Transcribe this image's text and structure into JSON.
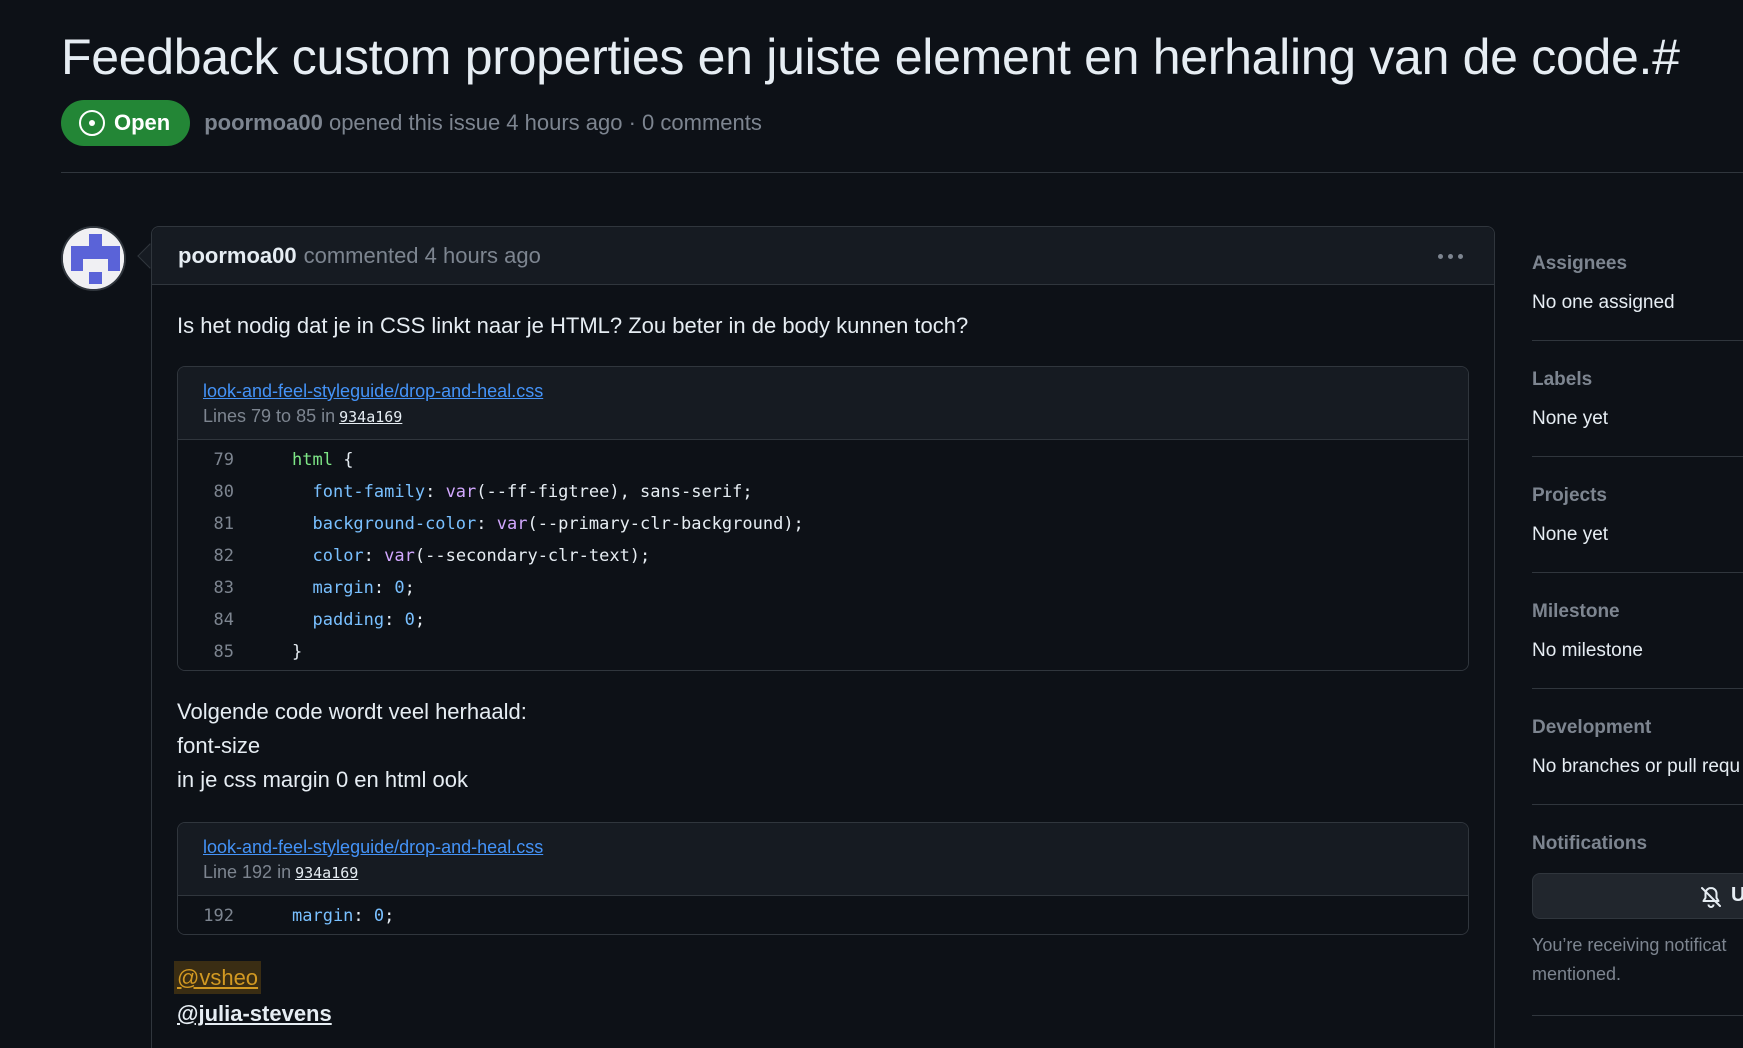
{
  "issue": {
    "title": "Feedback custom properties en juiste element en herhaling van de code.",
    "number_prefix": "#",
    "status": "Open",
    "author": "poormoa00",
    "meta_rest": "opened this issue 4 hours ago · 0 comments"
  },
  "comment": {
    "author": "poormoa00",
    "meta": "commented 4 hours ago",
    "paragraph1": "Is het nodig dat je in CSS linkt naar je HTML? Zou beter in de body kunnen toch?",
    "snippet1": {
      "file": "look-and-feel-styleguide/drop-and-heal.css",
      "range": "Lines 79 to 85 in",
      "sha": "934a169",
      "lines": [
        {
          "n": "79",
          "indent": "",
          "segments": [
            {
              "t": "html",
              "c": "sel"
            },
            {
              "t": " {",
              "c": ""
            }
          ]
        },
        {
          "n": "80",
          "indent": "  ",
          "segments": [
            {
              "t": "font-family",
              "c": "prop"
            },
            {
              "t": ": ",
              "c": ""
            },
            {
              "t": "var",
              "c": "fn"
            },
            {
              "t": "(--ff-figtree), sans-serif;",
              "c": ""
            }
          ]
        },
        {
          "n": "81",
          "indent": "  ",
          "segments": [
            {
              "t": "background-color",
              "c": "prop"
            },
            {
              "t": ": ",
              "c": ""
            },
            {
              "t": "var",
              "c": "fn"
            },
            {
              "t": "(--primary-clr-background);",
              "c": ""
            }
          ]
        },
        {
          "n": "82",
          "indent": "  ",
          "segments": [
            {
              "t": "color",
              "c": "prop"
            },
            {
              "t": ": ",
              "c": ""
            },
            {
              "t": "var",
              "c": "fn"
            },
            {
              "t": "(--secondary-clr-text);",
              "c": ""
            }
          ]
        },
        {
          "n": "83",
          "indent": "  ",
          "segments": [
            {
              "t": "margin",
              "c": "prop"
            },
            {
              "t": ": ",
              "c": ""
            },
            {
              "t": "0",
              "c": "num"
            },
            {
              "t": ";",
              "c": ""
            }
          ]
        },
        {
          "n": "84",
          "indent": "  ",
          "segments": [
            {
              "t": "padding",
              "c": "prop"
            },
            {
              "t": ": ",
              "c": ""
            },
            {
              "t": "0",
              "c": "num"
            },
            {
              "t": ";",
              "c": ""
            }
          ]
        },
        {
          "n": "85",
          "indent": "",
          "segments": [
            {
              "t": "}",
              "c": ""
            }
          ]
        }
      ]
    },
    "paragraph2_lines": [
      "Volgende code wordt veel herhaald:",
      "font-size",
      "in je css margin 0 en html ook"
    ],
    "snippet2": {
      "file": "look-and-feel-styleguide/drop-and-heal.css",
      "range": "Line 192 in",
      "sha": "934a169",
      "lines": [
        {
          "n": "192",
          "indent": "",
          "segments": [
            {
              "t": "margin",
              "c": "prop"
            },
            {
              "t": ": ",
              "c": ""
            },
            {
              "t": "0",
              "c": "num"
            },
            {
              "t": ";",
              "c": ""
            }
          ]
        }
      ]
    },
    "mention1": "@vsheo",
    "mention2": "@julia-stevens"
  },
  "sidebar": {
    "assignees_label": "Assignees",
    "assignees_value": "No one assigned",
    "labels_label": "Labels",
    "labels_value": "None yet",
    "projects_label": "Projects",
    "projects_value": "None yet",
    "milestone_label": "Milestone",
    "milestone_value": "No milestone",
    "development_label": "Development",
    "development_value": "No branches or pull requ",
    "notifications_label": "Notifications",
    "notifications_button": "U",
    "notifications_note_line1": "You’re receiving notificat",
    "notifications_note_line2": "mentioned."
  },
  "colors": {
    "background": "#0d1117",
    "open_badge": "#238636",
    "link": "#4493f8",
    "muted": "#7d8590"
  }
}
